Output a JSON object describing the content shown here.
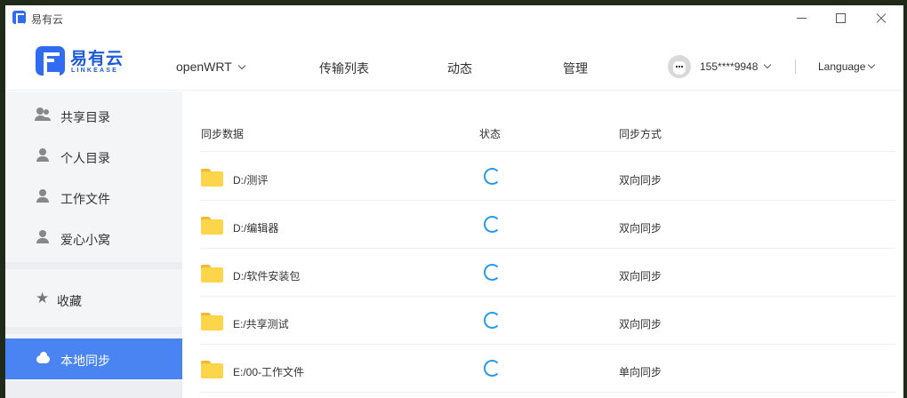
{
  "window": {
    "title": "易有云"
  },
  "logo": {
    "name": "易有云",
    "sub": "LINKEASE"
  },
  "nav": {
    "device": "openWRT",
    "items": [
      "传输列表",
      "动态",
      "管理"
    ],
    "user": "155****9948",
    "language": "Language"
  },
  "sidebar": {
    "items": [
      {
        "label": "共享目录",
        "icon": "users-icon"
      },
      {
        "label": "个人目录",
        "icon": "user-icon"
      },
      {
        "label": "工作文件",
        "icon": "user-icon"
      },
      {
        "label": "爱心小窝",
        "icon": "user-icon"
      }
    ],
    "favorites": {
      "label": "收藏",
      "icon": "star-icon"
    },
    "local_sync": {
      "label": "本地同步",
      "icon": "cloud-icon"
    }
  },
  "table": {
    "headers": [
      "同步数据",
      "状态",
      "同步方式"
    ],
    "rows": [
      {
        "name": "D:/测评",
        "mode": "双向同步"
      },
      {
        "name": "D:/编辑器",
        "mode": "双向同步"
      },
      {
        "name": "D:/软件安装包",
        "mode": "双向同步"
      },
      {
        "name": "E:/共享测试",
        "mode": "双向同步"
      },
      {
        "name": "E:/00-工作文件",
        "mode": "单向同步"
      }
    ]
  },
  "colors": {
    "accent": "#4a84f2",
    "brand": "#1d5bd8",
    "spinner": "#2a9ae6",
    "folder": "#fcd54b"
  }
}
